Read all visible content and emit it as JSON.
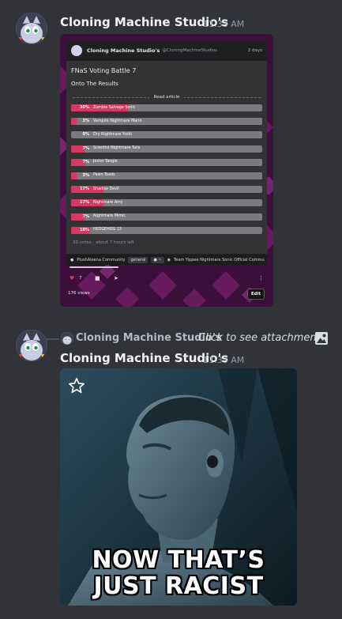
{
  "message1": {
    "username": "Cloning Machine Studio's",
    "timestamp": "11:33 AM",
    "embed": {
      "author": "Cloning Machine Studio's",
      "handle": "@CloningMachineStudios",
      "age": "2 days",
      "poll_title": "FNaS Voting Battle 7",
      "poll_subtitle": "Onto The Results",
      "read_article": "Read article",
      "options": [
        {
          "pct": "30%",
          "label": "Zombie Salvage Sonic",
          "value": 30
        },
        {
          "pct": "3%",
          "label": "Vampire Nightmare Mario",
          "value": 3
        },
        {
          "pct": "0%",
          "label": "Dry Nightmare Yoshi",
          "value": 0
        },
        {
          "pct": "7%",
          "label": "Scientist Nightmare Tails",
          "value": 7
        },
        {
          "pct": "7%",
          "label": "Jester Tangle",
          "value": 7
        },
        {
          "pct": "3%",
          "label": "Pawn Toads",
          "value": 3
        },
        {
          "pct": "17%",
          "label": "Shadow Devil",
          "value": 17
        },
        {
          "pct": "17%",
          "label": "Nightmare Amy",
          "value": 17
        },
        {
          "pct": "7%",
          "label": "Nightmare Mimic",
          "value": 7
        },
        {
          "pct": "10%",
          "label": "HEDGEHOG 13",
          "value": 10
        }
      ],
      "poll_meta": "30 votes · about 7 hours left",
      "community": {
        "name": "PlushAleena Community",
        "tag1": "general",
        "tag2": "● ~",
        "team": "Team Yippee Nightmare Sonic Official Commu"
      },
      "likes": "7",
      "views": "176 views",
      "edit_label": "Edit"
    }
  },
  "reply": {
    "username": "Cloning Machine Studio's",
    "text": "Click to see attachment"
  },
  "message2": {
    "username": "Cloning Machine Studio's",
    "timestamp": "11:33 AM",
    "gif_caption_line1": "NOW THAT’S",
    "gif_caption_line2": "JUST RACIST"
  },
  "colors": {
    "background": "#313338",
    "username": "#f2f3f5",
    "timestamp": "#949ba4",
    "poll_fill": "#d53a63",
    "poll_track": "#7a7a7f"
  }
}
